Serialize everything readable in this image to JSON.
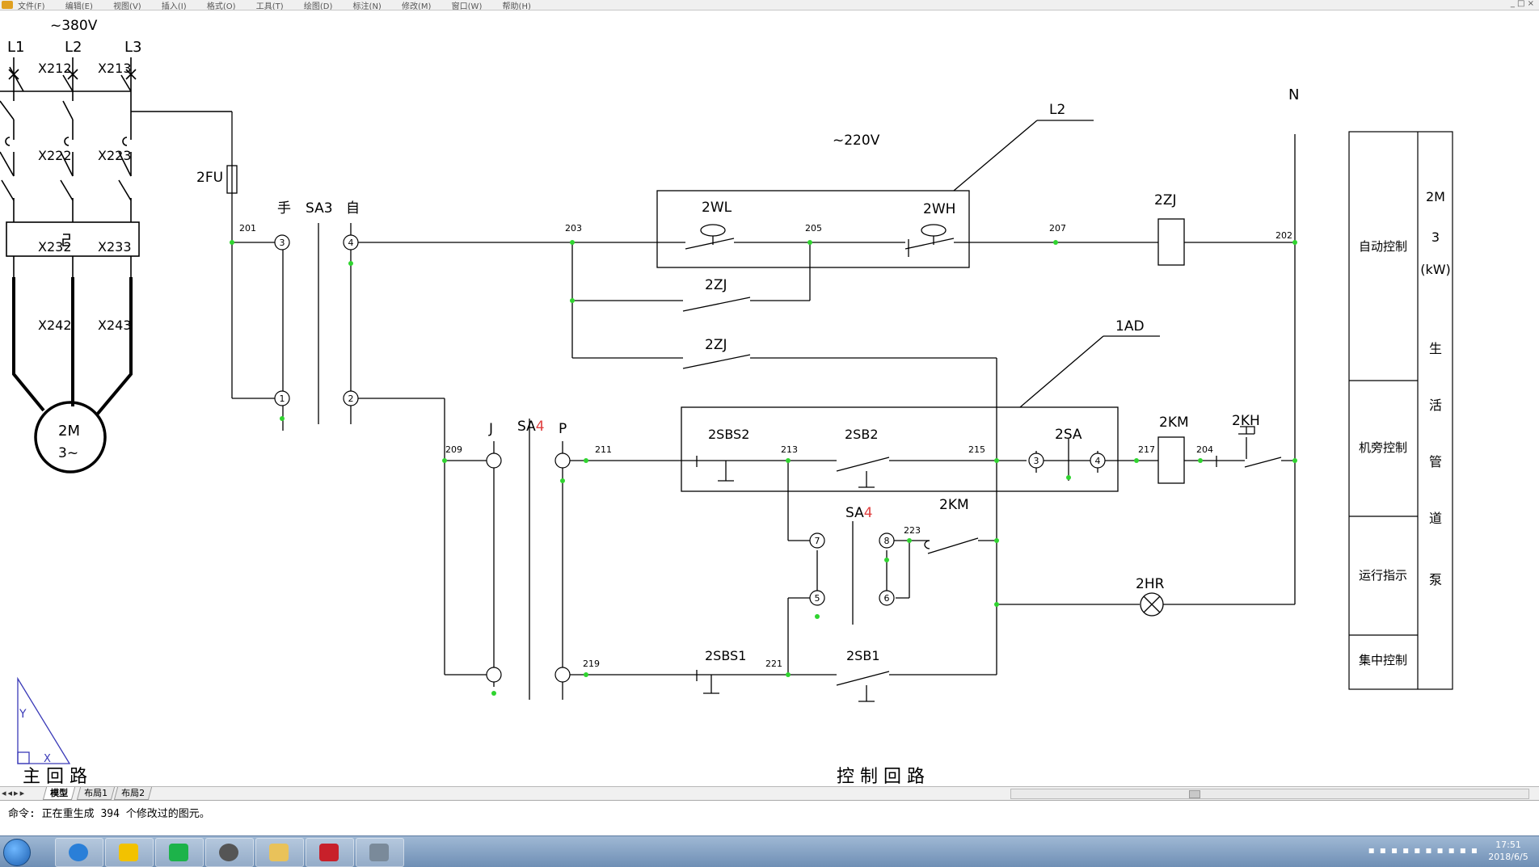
{
  "menubar": {
    "items": [
      "文件(F)",
      "编辑(E)",
      "视图(V)",
      "插入(I)",
      "格式(O)",
      "工具(T)",
      "绘图(D)",
      "标注(N)",
      "修改(M)",
      "窗口(W)",
      "帮助(H)"
    ],
    "window_controls": "_ □ ×"
  },
  "main_circuit": {
    "voltage": "~380V",
    "phases": [
      "L1",
      "L2",
      "L3"
    ],
    "switch_labels": [
      "X212",
      "X213"
    ],
    "contactor_labels": [
      "X222",
      "X223"
    ],
    "breaker_labels": [
      "X232",
      "X233"
    ],
    "relay_labels": [
      "X242",
      "X243"
    ],
    "motor_name": "2M",
    "motor_type": "3~",
    "title": "主 回 路"
  },
  "control_circuit": {
    "fuse": "2FU",
    "voltage": "~220V",
    "neutral": "N",
    "phase_tag": "L2",
    "box_tag": "1AD",
    "switch_sa3": "SA3",
    "manual": "手",
    "auto": "自",
    "switch_sa4": "SA",
    "switch_sa4_idx": "4",
    "j_label": "J",
    "p_label": "P",
    "float_low": "2WL",
    "float_high": "2WH",
    "relay": "2ZJ",
    "contactor": "2KM",
    "thermal": "2KH",
    "indicator": "2HR",
    "sbs2": "2SBS2",
    "sb2": "2SB2",
    "sbs1": "2SBS1",
    "sb1": "2SB1",
    "sa": "2SA",
    "nodes": [
      "201",
      "203",
      "205",
      "207",
      "202",
      "209",
      "211",
      "213",
      "215",
      "217",
      "204",
      "219",
      "221",
      "223"
    ],
    "terminal_numbers": [
      "1",
      "2",
      "3",
      "4",
      "5",
      "6",
      "7",
      "8"
    ],
    "title": "控 制 回 路"
  },
  "side_table": {
    "functions": [
      "自动控制",
      "机旁控制",
      "运行指示",
      "集中控制"
    ],
    "device": [
      "2M",
      "3",
      "(kW)"
    ],
    "device_name": [
      "生",
      "活",
      "管",
      "道",
      "泵"
    ]
  },
  "ucs_icon": {
    "y_label": "Y",
    "x_label": "X"
  },
  "layout_tabs": [
    "模型",
    "布局1",
    "布局2"
  ],
  "command_line": "命令: 正在重生成 394 个修改过的图元。",
  "clock": {
    "time": "17:51",
    "date": "2018/6/5"
  }
}
